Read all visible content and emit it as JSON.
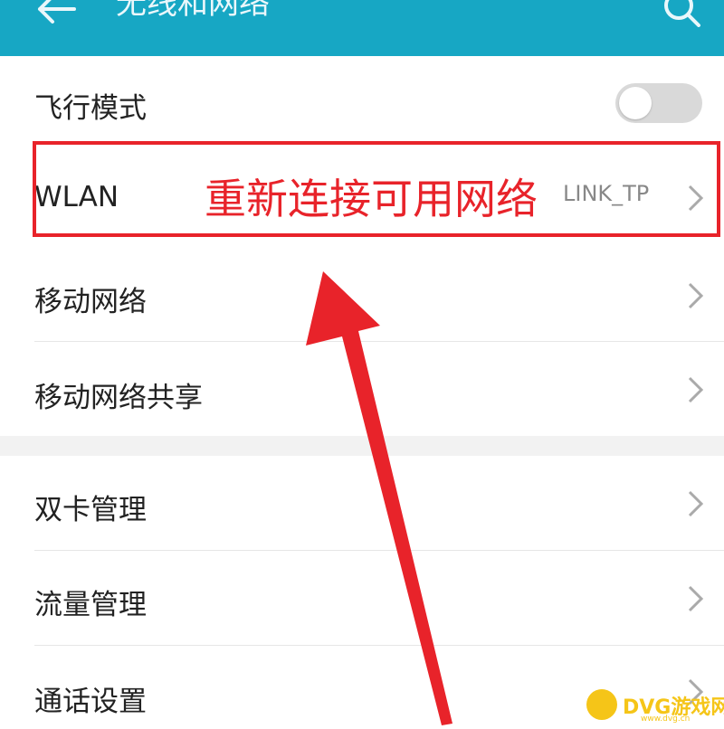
{
  "header": {
    "title": "无线和网络",
    "back_icon": "arrow-left-icon",
    "search_icon": "search-icon",
    "background": "#17a7c4"
  },
  "settings": [
    {
      "label": "飞行模式",
      "control": "toggle",
      "toggle_on": false
    },
    {
      "label": "WLAN",
      "value": "LINK_TP",
      "control": "chevron"
    },
    {
      "label": "移动网络",
      "control": "chevron"
    },
    {
      "label": "移动网络共享",
      "control": "chevron"
    },
    {
      "label": "双卡管理",
      "control": "chevron"
    },
    {
      "label": "流量管理",
      "control": "chevron"
    },
    {
      "label": "通话设置",
      "control": "chevron"
    }
  ],
  "annotation": {
    "text": "重新连接可用网络",
    "color": "#e8232a"
  },
  "watermark": {
    "text": "DVG游戏网",
    "sub": "www.dvg.cn"
  }
}
